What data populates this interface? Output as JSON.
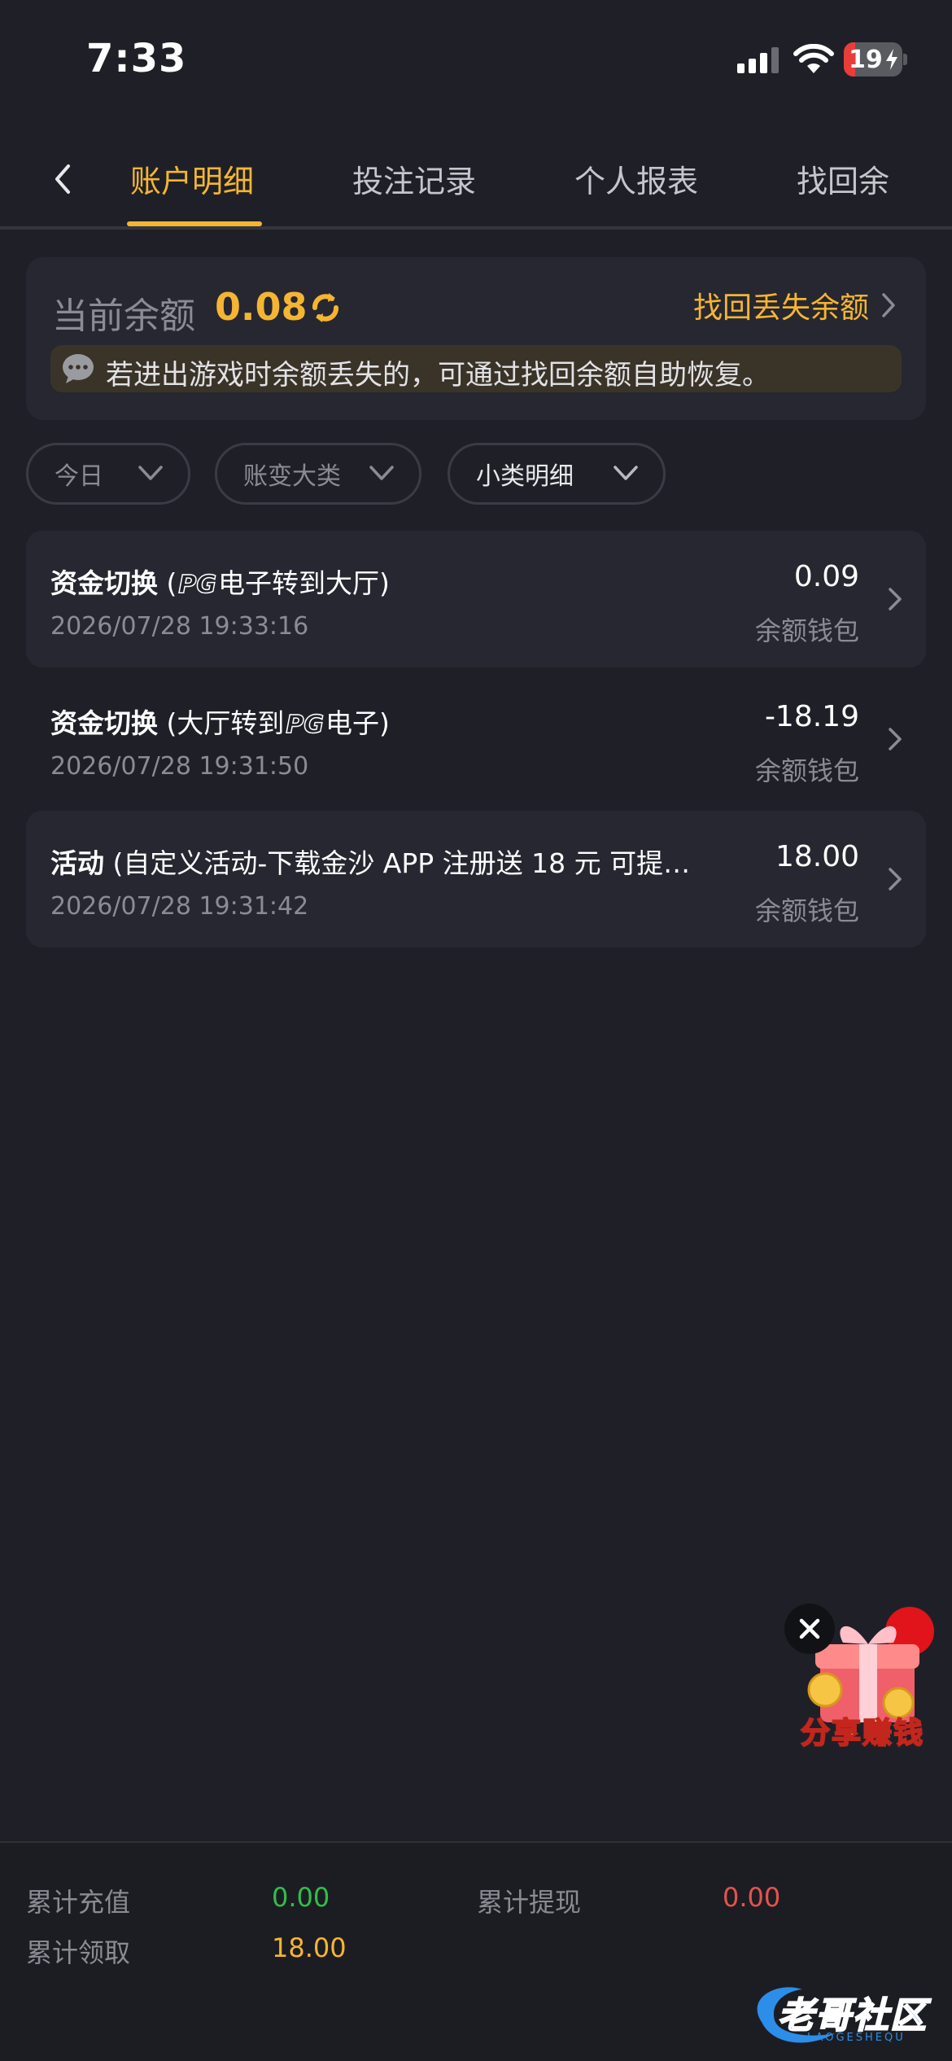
{
  "status_bar": {
    "time": "7:33",
    "battery_level": "19"
  },
  "tabs": [
    {
      "label": "账户明细",
      "active": true
    },
    {
      "label": "投注记录",
      "active": false
    },
    {
      "label": "个人报表",
      "active": false
    },
    {
      "label": "找回余",
      "active": false
    }
  ],
  "balance": {
    "label": "当前余额",
    "value": "0.08",
    "recover_link": "找回丢失余额",
    "notice": "若进出游戏时余额丢失的，可通过找回余额自助恢复。"
  },
  "filters": [
    {
      "label": "今日"
    },
    {
      "label": "账变大类"
    },
    {
      "label": "小类明细"
    }
  ],
  "records": [
    {
      "type": "资金切换",
      "detail_pre": " (",
      "logo": "PG",
      "detail_post": "电子转到大厅)",
      "time": "2026/07/28 19:33:16",
      "amount": "0.09",
      "wallet": "余额钱包"
    },
    {
      "type": "资金切换",
      "detail_pre": " (大厅转到",
      "logo": "PG",
      "detail_post": "电子)",
      "time": "2026/07/28 19:31:50",
      "amount": "-18.19",
      "wallet": "余额钱包"
    },
    {
      "type": "活动",
      "detail_pre": " (自定义活动-下载金沙 APP 注册送 18 元 可提…",
      "logo": "",
      "detail_post": "",
      "time": "2026/07/28 19:31:42",
      "amount": "18.00",
      "wallet": "余额钱包"
    }
  ],
  "promo": {
    "label": "分享赚钱"
  },
  "summary": {
    "deposit_label": "累计充值",
    "deposit_value": "0.00",
    "withdraw_label": "累计提现",
    "withdraw_value": "0.00",
    "claim_label": "累计领取",
    "claim_value": "18.00"
  },
  "watermark": {
    "text": "老哥社区",
    "sub": "LAOGESHEQU"
  },
  "colors": {
    "accent": "#f5b532",
    "deposit": "#2fbf4a",
    "withdraw": "#e5534b",
    "claim": "#f5b532"
  }
}
